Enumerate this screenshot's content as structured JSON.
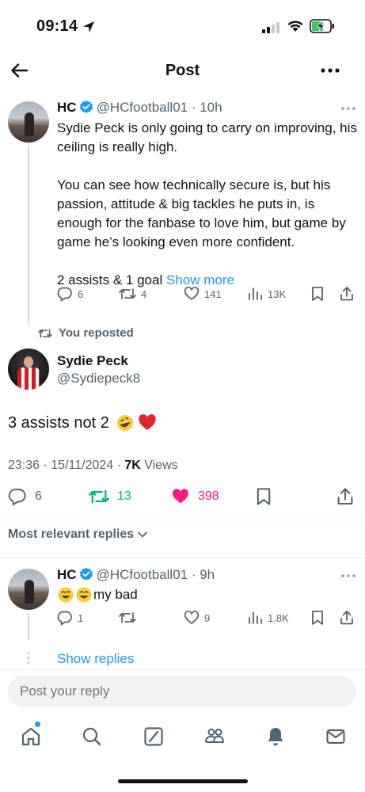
{
  "status": {
    "time": "09:14"
  },
  "header": {
    "title": "Post"
  },
  "parent_tweet": {
    "name": "HC",
    "handle": "@HCfootball01",
    "time": "10h",
    "line1": "Sydie Peck is only going to carry on improving, his ceiling is really high.",
    "line2": "You can see how technically secure is, but his passion, attitude & big tackles he puts in, is enough for the fanbase to love him, but game by game he’s looking even more confident.",
    "line3": "2 assists & 1 goal",
    "show_more": "Show more",
    "replies": "6",
    "reposts": "4",
    "likes": "141",
    "views": "13K"
  },
  "repost_label": "You reposted",
  "main_tweet": {
    "name": "Sydie Peck",
    "handle": "@Sydiepeck8",
    "text": "3 assists not 2",
    "time": "23:36",
    "date": "15/11/2024",
    "views_count": "7K",
    "views_label": "Views",
    "replies": "6",
    "reposts": "13",
    "likes": "398"
  },
  "sort_label": "Most relevant replies",
  "reply_tweet": {
    "name": "HC",
    "handle": "@HCfootball01",
    "time": "9h",
    "text": "my bad",
    "replies": "1",
    "reposts": "",
    "likes": "9",
    "views": "1.8K"
  },
  "show_replies": "Show replies",
  "composer": {
    "placeholder": "Post your reply"
  },
  "colors": {
    "accent": "#1d9bf0",
    "like": "#f91880",
    "repost": "#00ba7c",
    "muted": "#536471"
  },
  "icons": [
    "back-arrow-icon",
    "more-icon",
    "verified-icon",
    "reply-icon",
    "repost-icon",
    "like-icon",
    "views-icon",
    "bookmark-icon",
    "share-icon",
    "home-icon",
    "search-icon",
    "grok-icon",
    "communities-icon",
    "notifications-icon",
    "messages-icon"
  ]
}
